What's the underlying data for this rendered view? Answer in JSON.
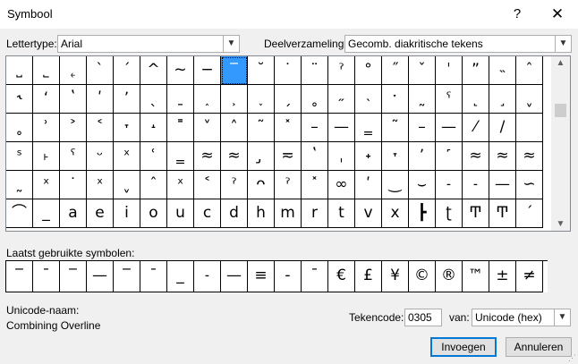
{
  "window": {
    "title": "Symbool",
    "help": "?",
    "close": "✕"
  },
  "font": {
    "label": "Lettertype:",
    "value": "Arial"
  },
  "subset": {
    "label": "Deelverzameling:",
    "value": "Gecomb. diakritische tekens"
  },
  "grid": {
    "selected_index": 8,
    "rows": [
      [
        "˽",
        "˾",
        "˿",
        "ˋ",
        "ˊ",
        "^",
        "~",
        "−",
        "‾",
        "˘",
        "˙",
        "¨",
        "ˀ",
        "°",
        "˝",
        "ˇ",
        "ˈ",
        "ˮ",
        "˵",
        "ˆ"
      ],
      [
        "˞",
        "ʻ",
        "ʽ",
        "ʹ",
        "ʼ",
        "ˎ",
        "ˍ",
        "˰",
        "˲",
        "˯",
        "ˏ",
        "˳",
        "˶",
        "˴",
        "ˑ",
        "˷",
        "ˁ",
        "˻",
        "˼",
        "ˬ"
      ],
      [
        "˳",
        "ʾ",
        "˃",
        "˂",
        "˕",
        "˔",
        "˭",
        "˅",
        "˄",
        "˜",
        "˟",
        "–",
        "—",
        "‗",
        "˜",
        "–",
        "—",
        "⁄",
        "/",
        " "
      ],
      [
        "ˢ",
        "˫",
        "ˤ",
        "ᵕ",
        "ˣ",
        "ʿ",
        "‗",
        "≈",
        "≈",
        "̡",
        "≂",
        "ʽ",
        "ˌ",
        "˖",
        "˕",
        "ʼ",
        "˹",
        "≈",
        "≈",
        "≈"
      ],
      [
        "˷",
        "ˣ",
        "˙",
        "ˣ",
        "ˬ",
        "ˆ",
        "ˣ",
        "˂",
        "ˀ",
        "ᴖ",
        "ˀ",
        "˟",
        "∞",
        "ʹ",
        "‿",
        "⌣",
        "˗",
        "˗",
        "—",
        "∽"
      ],
      [
        "⌒",
        "_",
        "a",
        "e",
        "i",
        "o",
        "u",
        "c",
        "d",
        "h",
        "m",
        "r",
        "t",
        "v",
        "x",
        "┣",
        "ʈ",
        "Ͳ",
        "Ͳ",
        "ˊ"
      ]
    ]
  },
  "recent": {
    "label": "Laatst gebruikte symbolen:",
    "symbols": [
      "‾",
      "¯",
      "‾",
      "—",
      "‾",
      "¯",
      "_",
      "˗",
      "—",
      "≡",
      "-",
      "¯",
      "€",
      "£",
      "¥",
      "©",
      "®",
      "™",
      "±",
      "≠"
    ]
  },
  "unicode_name": {
    "label": "Unicode-naam:",
    "value": "Combining Overline"
  },
  "char_code": {
    "label": "Tekencode:",
    "value": "0305"
  },
  "from": {
    "label": "van:",
    "value": "Unicode (hex)"
  },
  "buttons": {
    "insert": "Invoegen",
    "cancel": "Annuleren"
  }
}
